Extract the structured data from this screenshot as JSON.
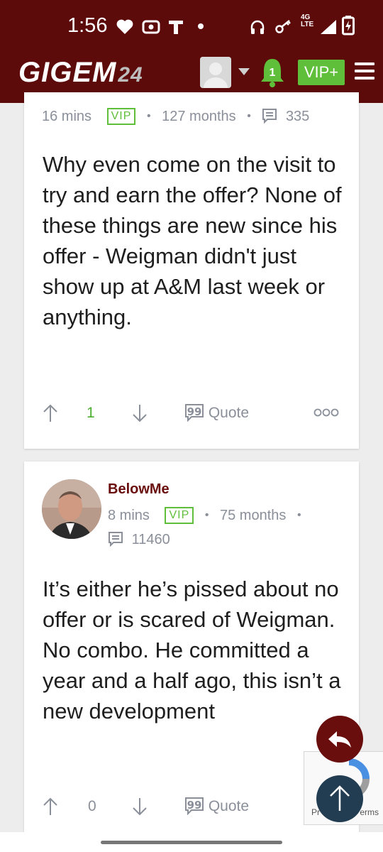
{
  "status_bar": {
    "time": "1:56",
    "network": "4G LTE",
    "icons": [
      "heart-icon",
      "radio-icon",
      "t-mobile-icon",
      "dot-icon",
      "headphones-icon",
      "key-icon",
      "signal-icon",
      "battery-charging-icon"
    ]
  },
  "header": {
    "logo_text": "GIGEM",
    "logo_number": "24",
    "notification_count": "1",
    "vip_button": "VIP+",
    "colors": {
      "header_bg": "#5c0a0a",
      "vip_green": "#5fbf3a"
    }
  },
  "posts": [
    {
      "time": "16 mins",
      "badge": "VIP",
      "tenure": "127 months",
      "post_count": "335",
      "text": "Why even come on the visit to try and earn the offer? None of these things are new since his offer - Weigman didn't just show up at A&M last week or anything.",
      "votes": "1",
      "quote_label": "Quote"
    },
    {
      "username": "BelowMe",
      "time": "8 mins",
      "badge": "VIP",
      "tenure": "75 months",
      "post_count": "11460",
      "text": "It’s either he’s pissed about no offer or is scared of Weigman. No combo. He committed a year and a half ago, this isn’t a new development",
      "votes": "0",
      "quote_label": "Quote"
    }
  ],
  "recaptcha": {
    "text_left": "Pr",
    "text_right": "erms"
  }
}
